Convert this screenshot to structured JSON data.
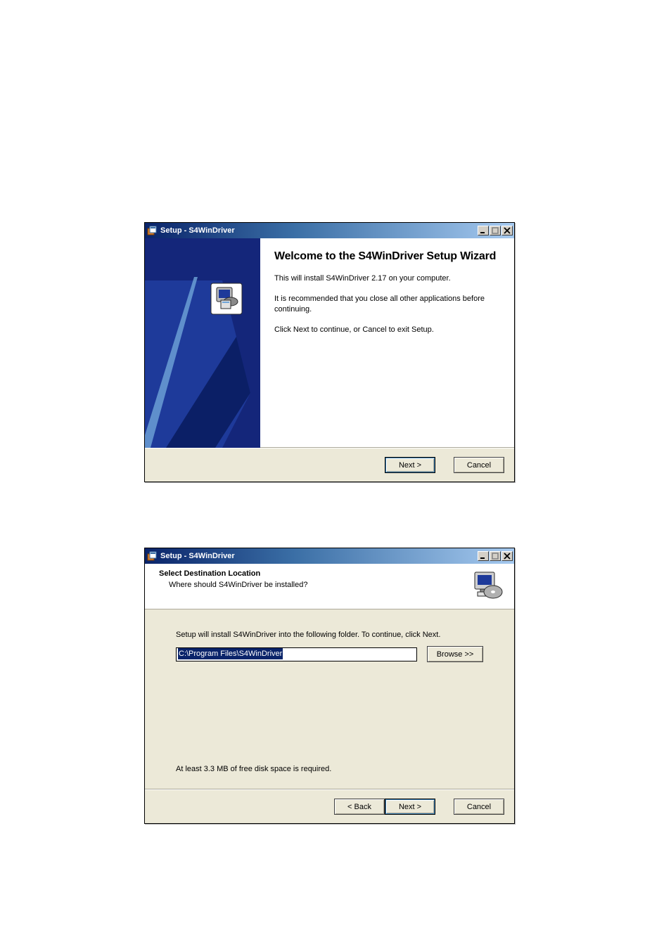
{
  "dialog1": {
    "title": "Setup - S4WinDriver",
    "heading": "Welcome to the S4WinDriver Setup Wizard",
    "para1": "This will install S4WinDriver 2.17 on your computer.",
    "para2": "It is recommended that you close all other applications before continuing.",
    "para3": "Click Next to continue, or Cancel to exit Setup.",
    "next_label": "Next >",
    "cancel_label": "Cancel"
  },
  "dialog2": {
    "title": "Setup - S4WinDriver",
    "header_title": "Select Destination Location",
    "header_sub": "Where should S4WinDriver be installed?",
    "instruction": "Setup will install S4WinDriver into the following folder. To continue, click Next.",
    "path_value": "C:\\Program Files\\S4WinDriver",
    "browse_label": "Browse >>",
    "space_req": "At least 3.3 MB of free disk space is required.",
    "back_label": "< Back",
    "next_label": "Next >",
    "cancel_label": "Cancel"
  }
}
